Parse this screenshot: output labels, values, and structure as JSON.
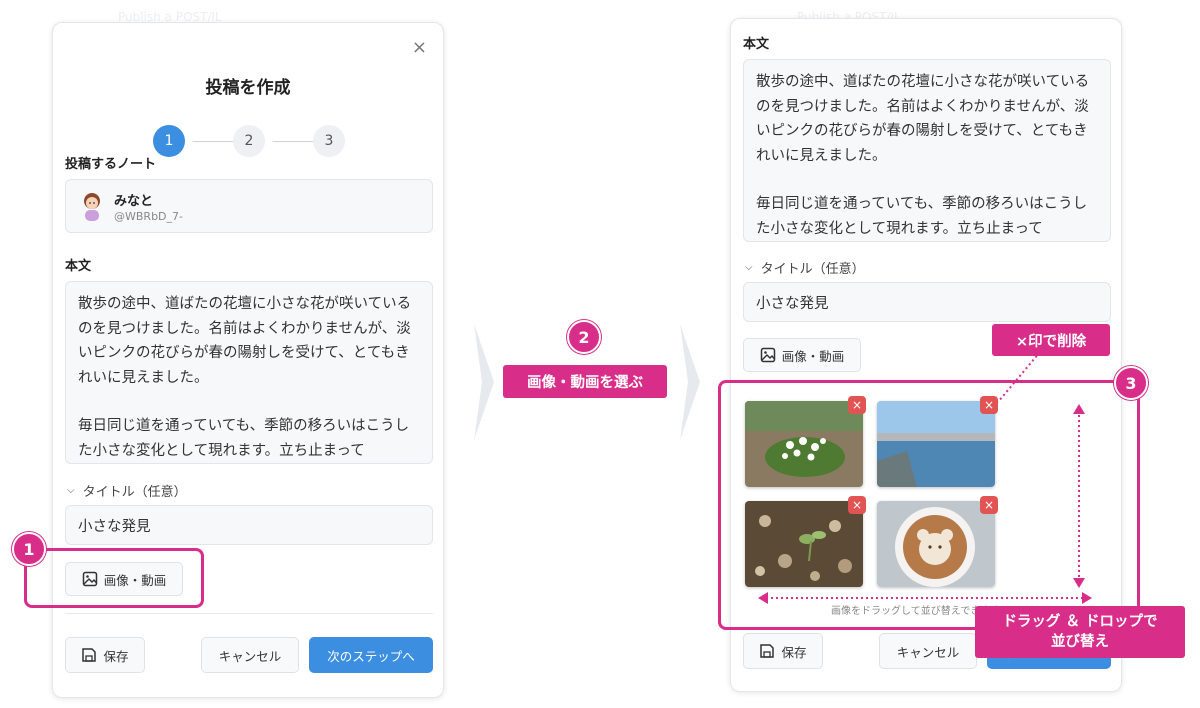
{
  "modal": {
    "title": "投稿を作成",
    "close_icon": "×",
    "steps": [
      "1",
      "2",
      "3"
    ],
    "note_label": "投稿するノート",
    "account": {
      "name": "みなと",
      "handle": "@WBRbD_7-"
    },
    "body_label": "本文",
    "body_paragraphs": [
      "散歩の途中、道ばたの花壇に小さな花が咲いているのを見つけました。名前はよくわかりませんが、淡いピンクの花びらが春の陽射しを受けて、とてもきれいに見えました。",
      "毎日同じ道を通っていても、季節の移ろいはこうした小さな変化として現れます。立ち止まって"
    ],
    "title_toggle": "タイトル（任意）",
    "title_value": "小さな発見",
    "media_button": "画像・動画",
    "save_button": "保存",
    "cancel_button": "キャンセル",
    "next_button": "次のステップへ",
    "drag_hint": "画像をドラッグして並び替えできます"
  },
  "ghost_text": "Publish a POST/IL",
  "callouts": {
    "step1": "1",
    "step2": "2",
    "step2_label": "画像・動画を選ぶ",
    "step3": "3",
    "delete_label": "×印で削除",
    "reorder_label_line1": "ドラッグ ＆ ドロップで",
    "reorder_label_line2": "並び替え"
  },
  "colors": {
    "accent": "#3b8ee0",
    "annotation": "#d92d8a",
    "delete": "#e25454"
  }
}
